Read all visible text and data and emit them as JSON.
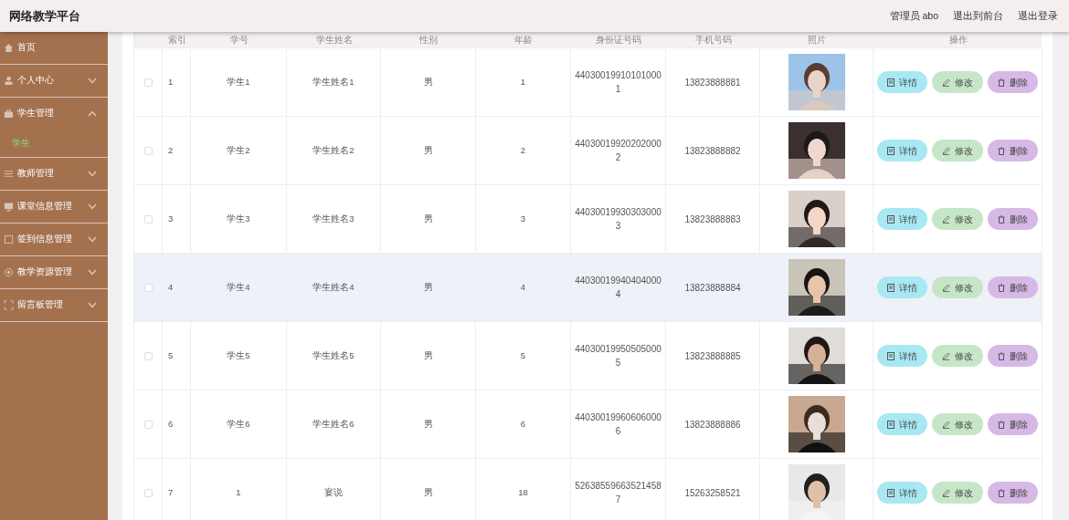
{
  "header": {
    "title": "网络教学平台",
    "links": [
      "管理员 abo",
      "退出到前台",
      "退出登录"
    ]
  },
  "sidebar": {
    "items": [
      {
        "label": "首页"
      },
      {
        "label": "个人中心",
        "expanded": false
      },
      {
        "label": "学生管理",
        "expanded": true,
        "children": [
          {
            "label": "学生",
            "selected": true
          }
        ]
      },
      {
        "label": "教师管理",
        "expanded": false
      },
      {
        "label": "课堂信息管理",
        "expanded": false
      },
      {
        "label": "签到信息管理",
        "expanded": false
      },
      {
        "label": "教学资源管理",
        "expanded": false
      },
      {
        "label": "留言板管理",
        "expanded": false
      }
    ]
  },
  "table": {
    "columns": [
      "索引",
      "学号",
      "学生姓名",
      "性别",
      "年龄",
      "身份证号码",
      "手机号码",
      "照片",
      "操作"
    ],
    "rows": [
      {
        "index": "1",
        "student_no": "学生1",
        "name": "学生姓名1",
        "gender": "男",
        "age": "1",
        "id_number": "440300199101010001",
        "phone": "13823888881",
        "checked": false,
        "hovered": false,
        "actions": [
          "详情",
          "修改",
          "删除"
        ]
      },
      {
        "index": "2",
        "student_no": "学生2",
        "name": "学生姓名2",
        "gender": "男",
        "age": "2",
        "id_number": "440300199202020002",
        "phone": "13823888882",
        "checked": false,
        "hovered": false,
        "actions": [
          "详情",
          "修改",
          "删除"
        ]
      },
      {
        "index": "3",
        "student_no": "学生3",
        "name": "学生姓名3",
        "gender": "男",
        "age": "3",
        "id_number": "440300199303030003",
        "phone": "13823888883",
        "checked": false,
        "hovered": false,
        "actions": [
          "详情",
          "修改",
          "删除"
        ]
      },
      {
        "index": "4",
        "student_no": "学生4",
        "name": "学生姓名4",
        "gender": "男",
        "age": "4",
        "id_number": "440300199404040004",
        "phone": "13823888884",
        "checked": false,
        "hovered": true,
        "actions": [
          "详情",
          "修改",
          "删除"
        ]
      },
      {
        "index": "5",
        "student_no": "学生5",
        "name": "学生姓名5",
        "gender": "男",
        "age": "5",
        "id_number": "440300199505050005",
        "phone": "13823888885",
        "checked": false,
        "hovered": false,
        "actions": [
          "详情",
          "修改",
          "删除"
        ]
      },
      {
        "index": "6",
        "student_no": "学生6",
        "name": "学生姓名6",
        "gender": "男",
        "age": "6",
        "id_number": "440300199606060006",
        "phone": "13823888886",
        "checked": false,
        "hovered": false,
        "actions": [
          "详情",
          "修改",
          "删除"
        ]
      },
      {
        "index": "7",
        "student_no": "1",
        "name": "宴说",
        "gender": "男",
        "age": "18",
        "id_number": "526385596635214587",
        "phone": "15263258521",
        "checked": false,
        "hovered": false,
        "actions": [
          "详情",
          "修改",
          "删除"
        ]
      }
    ]
  }
}
